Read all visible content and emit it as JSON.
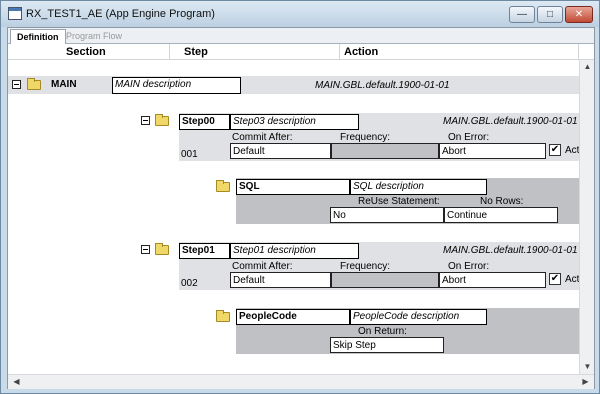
{
  "window": {
    "title": "RX_TEST1_AE (App Engine Program)",
    "buttons": {
      "minimize": "—",
      "maximize": "□",
      "close": "✕"
    }
  },
  "tabs": [
    {
      "label": "Definition",
      "active": true
    },
    {
      "label": "Program Flow",
      "active": false
    }
  ],
  "columns": {
    "section": "Section",
    "step": "Step",
    "action": "Action"
  },
  "section": {
    "name": "MAIN",
    "description": "MAIN description",
    "market_info": "MAIN.GBL.default.1900-01-01"
  },
  "steps": [
    {
      "name": "Step00",
      "description": "Step03 description",
      "market_info": "MAIN.GBL.default.1900-01-01",
      "number": "001",
      "commit_after_label": "Commit After:",
      "commit_after": "Default",
      "frequency_label": "Frequency:",
      "frequency": "",
      "on_error_label": "On Error:",
      "on_error": "Abort",
      "active_label": "Active",
      "active": true,
      "action": {
        "type": "SQL",
        "description": "SQL description",
        "field1_label": "ReUse Statement:",
        "field1_value": "No",
        "field2_label": "No Rows:",
        "field2_value": "Continue"
      }
    },
    {
      "name": "Step01",
      "description": "Step01 description",
      "market_info": "MAIN.GBL.default.1900-01-01",
      "number": "002",
      "commit_after_label": "Commit After:",
      "commit_after": "Default",
      "frequency_label": "Frequency:",
      "frequency": "",
      "on_error_label": "On Error:",
      "on_error": "Abort",
      "active_label": "Active",
      "active": true,
      "action": {
        "type": "PeopleCode",
        "description": "PeopleCode description",
        "field1_label": "On Return:",
        "field1_value": "Skip Step"
      }
    }
  ],
  "icons": {
    "collapse": "minus-box-icon",
    "folder": "folder-icon",
    "check": "✔",
    "scroll_up": "▲",
    "scroll_down": "▼",
    "scroll_left": "◀",
    "scroll_right": "▶"
  }
}
